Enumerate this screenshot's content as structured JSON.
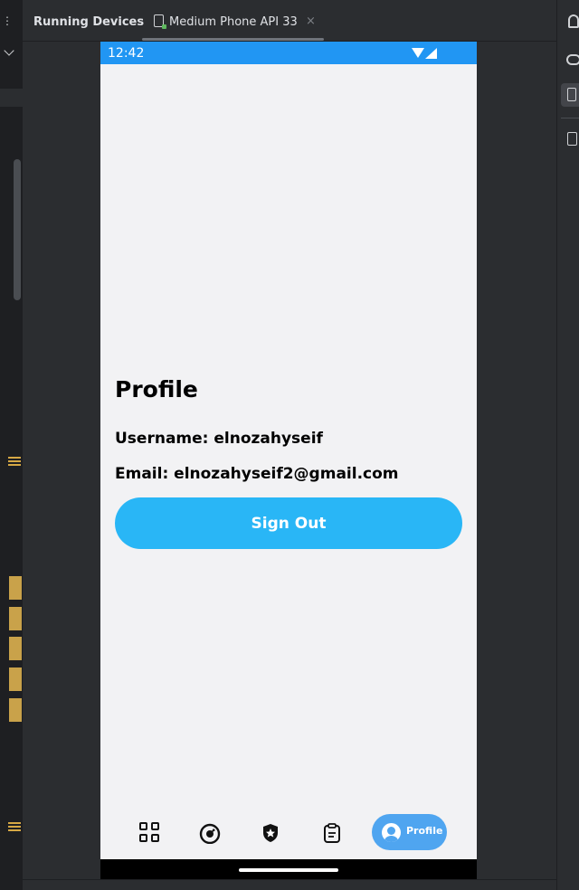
{
  "ide": {
    "panel_title": "Running Devices",
    "device_tab_label": "Medium Phone API 33",
    "close_symbol": "×"
  },
  "phone": {
    "status_time": "12:42",
    "status_bar_color": "#2196f3",
    "profile": {
      "title": "Profile",
      "username_line": "Username: elnozahyseif",
      "email_line": "Email: elnozahyseif2@gmail.com",
      "sign_out_label": "Sign Out",
      "accent_color": "#29b6f6"
    },
    "bottom_nav": {
      "items": [
        {
          "icon": "grid-icon"
        },
        {
          "icon": "gauge-icon"
        },
        {
          "icon": "badge-star-icon"
        },
        {
          "icon": "clipboard-icon"
        },
        {
          "icon": "profile-avatar-icon",
          "label": "Profile",
          "selected": true
        }
      ],
      "selected_color": "#4fa5f0"
    }
  }
}
